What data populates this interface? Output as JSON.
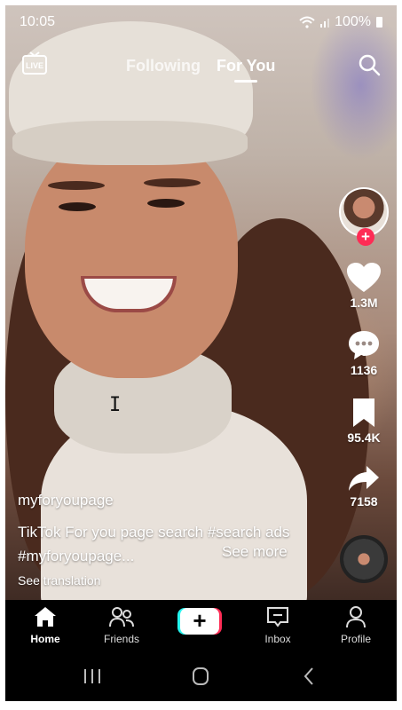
{
  "status_bar": {
    "time": "10:05",
    "battery": "100%"
  },
  "top_nav": {
    "tabs": [
      "Following",
      "For You"
    ],
    "active_tab": "For You",
    "live_icon": "live-tv-icon",
    "search_icon": "search-icon"
  },
  "rail": {
    "likes": "1.3M",
    "comments": "1136",
    "bookmarks": "95.4K",
    "shares": "7158"
  },
  "caption": {
    "username": "myforyoupage",
    "line1": "TikTok For you page search #search ads",
    "line2": "#myforyoupage...",
    "see_more": "See more",
    "see_translation": "See translation"
  },
  "bottom_nav": {
    "home": "Home",
    "friends": "Friends",
    "inbox": "Inbox",
    "profile": "Profile"
  },
  "colors": {
    "accent": "#fe2c55",
    "cyan": "#25f4ee"
  }
}
